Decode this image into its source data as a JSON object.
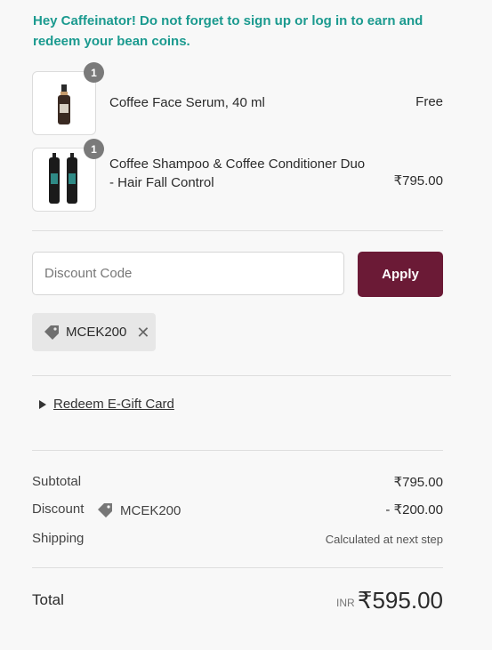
{
  "banner": "Hey Caffeinator! Do not forget to sign up or log in to earn and redeem your bean coins.",
  "items": [
    {
      "name": "Coffee Face Serum, 40 ml",
      "price": "Free",
      "qty": "1"
    },
    {
      "name": "Coffee Shampoo & Coffee Conditioner Duo - Hair Fall Control",
      "price": "₹795.00",
      "qty": "1"
    }
  ],
  "discount": {
    "placeholder": "Discount Code",
    "apply_label": "Apply",
    "applied_code": "MCEK200"
  },
  "gift_card": {
    "label": "Redeem E-Gift Card"
  },
  "summary": {
    "subtotal_label": "Subtotal",
    "subtotal_value": "₹795.00",
    "discount_label": "Discount",
    "discount_code": "MCEK200",
    "discount_value": "- ₹200.00",
    "shipping_label": "Shipping",
    "shipping_value": "Calculated at next step",
    "total_label": "Total",
    "currency": "INR",
    "total_value": "₹595.00"
  },
  "colors": {
    "banner": "#1b9a8f",
    "apply_button": "#6b1a36",
    "qty_badge": "#7a7a7a"
  }
}
